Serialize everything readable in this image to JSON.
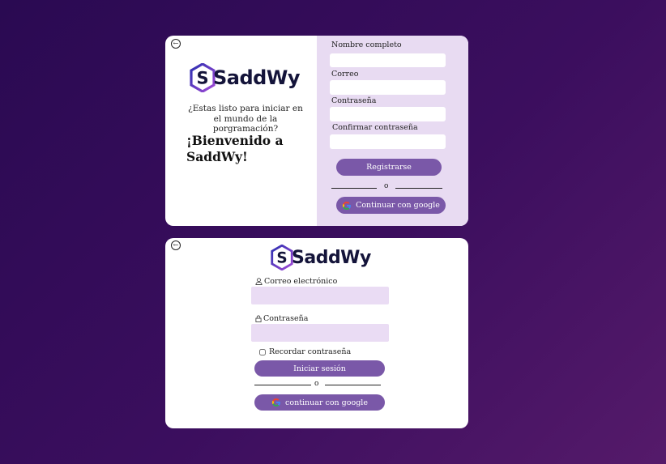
{
  "brand": {
    "name": "SaddWy",
    "letter": "S"
  },
  "register": {
    "tagline": "¿Estas listo para iniciar en el mundo de la porgramación?",
    "welcome": "¡Bienvenido a SaddWy!",
    "fields": {
      "name_label": "Nombre completo",
      "email_label": "Correo",
      "password_label": "Contraseña",
      "confirm_label": "Confirmar contraseña"
    },
    "submit_label": "Registrarse",
    "or_label": "o",
    "google_label": "Continuar con google"
  },
  "login": {
    "email_label": "Correo electrónico",
    "password_label": "Contraseña",
    "remember_label": "Recordar contraseña",
    "submit_label": "Iniciar sesión",
    "or_label": "o",
    "google_label": "continuar con google"
  },
  "icons": {
    "back": "back-arrow-icon",
    "user": "user-icon",
    "lock": "lock-icon",
    "google": "google-icon"
  },
  "colors": {
    "accent": "#7a58a8",
    "panel": "#e8dbf2",
    "input_bg": "#eadcf4",
    "logo_text": "#14143a"
  }
}
